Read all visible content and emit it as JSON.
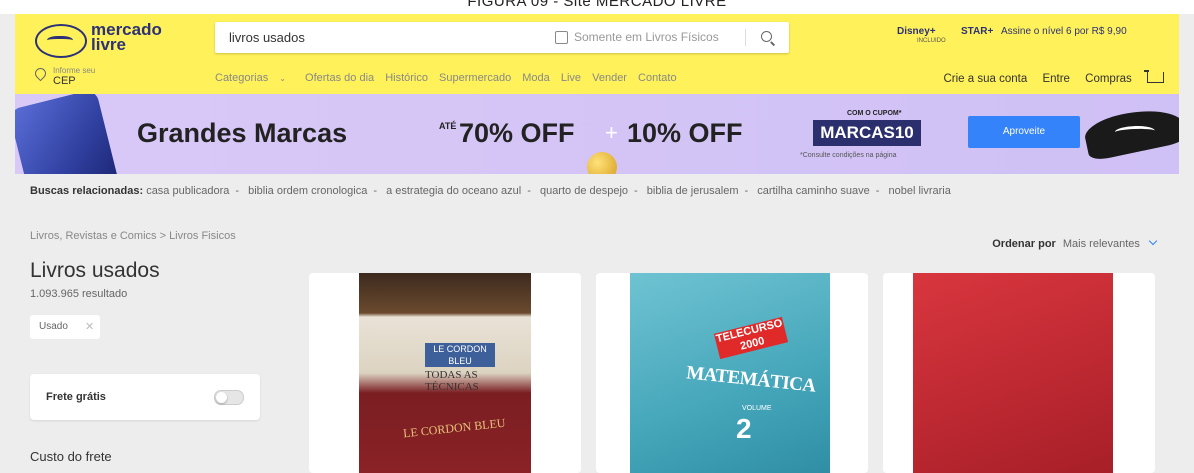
{
  "caption": "FIGURA 09 - Site MERCADO LIVRE",
  "header": {
    "logo_line1": "mercado",
    "logo_line2": "livre",
    "search": {
      "value": "livros usados",
      "checkbox_label": "Somente em Livros Físicos"
    },
    "promo": {
      "disney": "Disney+",
      "incluido": "INCLUIDO",
      "star": "STAR+",
      "text": "Assine o nível 6 por R$ 9,90"
    },
    "cep": {
      "line1": "Informe seu",
      "line2": "CEP"
    },
    "nav": [
      "Categorias",
      "Ofertas do dia",
      "Histórico",
      "Supermercado",
      "Moda",
      "Live",
      "Vender",
      "Contato"
    ],
    "account": [
      "Crie a sua conta",
      "Entre",
      "Compras"
    ]
  },
  "banner": {
    "headline": "Grandes Marcas",
    "ate": "ATÉ",
    "discount1": "70% OFF",
    "plus": "+",
    "discount2": "10% OFF",
    "coupon_top": "COM O CUPOM*",
    "coupon_code": "MARCAS10",
    "conditions": "*Consulte condições na página",
    "cta": "Aproveite"
  },
  "related": {
    "label": "Buscas relacionadas:",
    "items": [
      "casa publicadora",
      "biblia ordem cronologica",
      "a estrategia do oceano azul",
      "quarto de despejo",
      "biblia de jerusalem",
      "cartilha caminho suave",
      "nobel livraria"
    ]
  },
  "breadcrumb": "Livros, Revistas e Comics > Livros Fisicos",
  "order": {
    "label": "Ordenar por",
    "value": "Mais relevantes"
  },
  "page": {
    "title": "Livros usados",
    "count": "1.093.965 resultado"
  },
  "filters": {
    "chip": "Usado",
    "chip_close": "✕",
    "free_shipping": "Frete grátis",
    "shipping_cost": "Custo do frete"
  },
  "books": {
    "b1": {
      "tag": "LE CORDON BLEU",
      "title": "TODAS AS",
      "subtitle": "TÉCNICAS",
      "footer": "LE CORDON BLEU"
    },
    "b2": {
      "tag": "TELECURSO 2000",
      "title": "MATEMÁTICA",
      "volume": "VOLUME",
      "number": "2"
    }
  },
  "colors": {
    "header_bg": "#fff159",
    "brand_blue": "#2d3277",
    "accent": "#3483fa",
    "banner_bg": "#d9c9f7"
  }
}
